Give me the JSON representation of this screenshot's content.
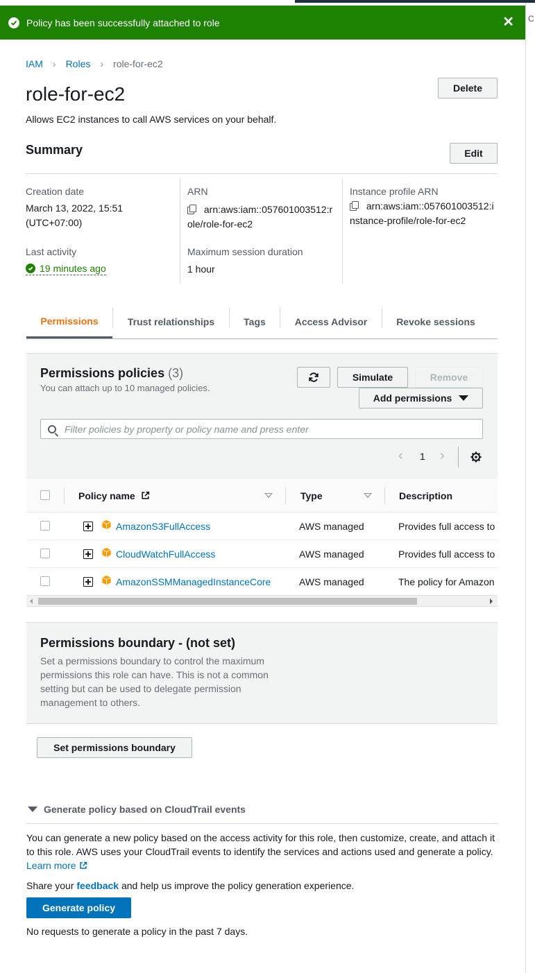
{
  "flash": {
    "message": "Policy has been successfully attached to role"
  },
  "edge_char": "C",
  "breadcrumb": {
    "items": [
      "IAM",
      "Roles"
    ],
    "current": "role-for-ec2"
  },
  "role": {
    "name": "role-for-ec2",
    "description": "Allows EC2 instances to call AWS services on your behalf.",
    "delete_label": "Delete"
  },
  "summary": {
    "heading": "Summary",
    "edit_label": "Edit",
    "creation_date_label": "Creation date",
    "creation_date_value": "March 13, 2022, 15:51",
    "creation_date_tz": "(UTC+07:00)",
    "last_activity_label": "Last activity",
    "last_activity_value": "19 minutes ago",
    "arn_label": "ARN",
    "arn_line1": "arn:aws:iam::057601003512:r",
    "arn_line2": "ole/role-for-ec2",
    "max_session_label": "Maximum session duration",
    "max_session_value": "1 hour",
    "profile_arn_label": "Instance profile ARN",
    "profile_arn_line1": "arn:aws:iam::057601003512:i",
    "profile_arn_line2": "nstance-profile/role-for-ec2"
  },
  "tabs": [
    "Permissions",
    "Trust relationships",
    "Tags",
    "Access Advisor",
    "Revoke sessions"
  ],
  "permissions": {
    "heading": "Permissions policies",
    "count": "(3)",
    "subtitle": "You can attach up to 10 managed policies.",
    "simulate_label": "Simulate",
    "remove_label": "Remove",
    "add_label": "Add permissions",
    "filter_placeholder": "Filter policies by property or policy name and press enter",
    "page": "1",
    "columns": {
      "name": "Policy name",
      "type": "Type",
      "description": "Description"
    },
    "rows": [
      {
        "name": "AmazonS3FullAccess",
        "type": "AWS managed",
        "description": "Provides full access to"
      },
      {
        "name": "CloudWatchFullAccess",
        "type": "AWS managed",
        "description": "Provides full access to"
      },
      {
        "name": "AmazonSSMManagedInstanceCore",
        "type": "AWS managed",
        "description": "The policy for Amazon"
      }
    ]
  },
  "boundary": {
    "heading": "Permissions boundary - (not set)",
    "description": "Set a permissions boundary to control the maximum permissions this role can have. This is not a common setting but can be used to delegate permission management to others.",
    "button_label": "Set permissions boundary"
  },
  "generate": {
    "heading": "Generate policy based on CloudTrail events",
    "description": "You can generate a new policy based on the access activity for this role, then customize, create, and attach it to this role. AWS uses your CloudTrail events to identify the services and actions used and generate a policy.",
    "learn_more": "Learn more",
    "share_prefix": "Share your",
    "share_link": "feedback",
    "share_suffix": "and help us improve the policy generation experience.",
    "button_label": "Generate policy",
    "no_requests": "No requests to generate a policy in the past 7 days."
  },
  "colors": {
    "success": "#1d8102",
    "link": "#0073bb",
    "active_tab": "#ec7211",
    "primary": "#0073bb"
  }
}
